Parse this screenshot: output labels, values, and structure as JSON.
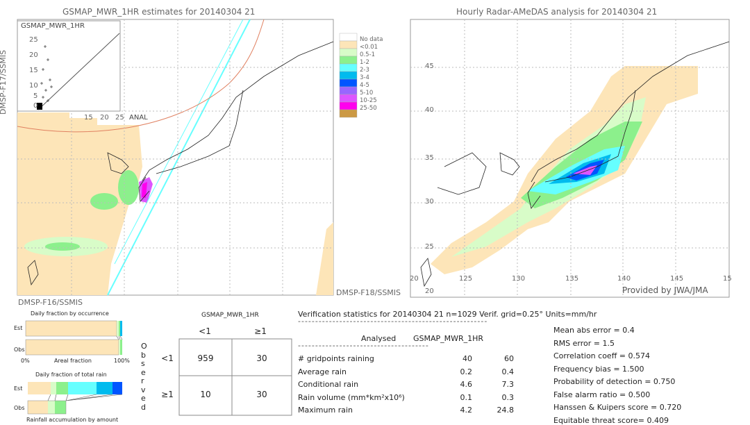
{
  "left_map": {
    "title": "GSMAP_MWR_1HR estimates for 20140304 21",
    "left_label": "DMSP-F17/SSMIS",
    "bottom_left_label": "DMSP-F16/SSMIS",
    "bottom_right_label": "DMSP-F18/SSMIS",
    "inset": {
      "title": "GSMAP_MWR_1HR",
      "xlabel": "ANAL",
      "yticks": [
        "25",
        "20",
        "15",
        "10",
        "5",
        "0"
      ],
      "xticks": [
        "15",
        "20",
        "25"
      ]
    }
  },
  "right_map": {
    "title": "Hourly Radar-AMeDAS analysis for 20140304 21",
    "lat_labels": [
      "45",
      "40",
      "35",
      "30",
      "25",
      "20"
    ],
    "lon_labels": [
      "125",
      "130",
      "135",
      "140",
      "145",
      "15"
    ],
    "left_bottom_label": "20",
    "credit": "Provided by JWA/JMA"
  },
  "legend": [
    {
      "label": "No data",
      "color": "#ffffff"
    },
    {
      "label": "No data",
      "color": "#fde5b8"
    },
    {
      "label": "<0.01",
      "color": "#d8fcc8"
    },
    {
      "label": "0.5-1",
      "color": "#8cf08c"
    },
    {
      "label": "1-2",
      "color": "#66ffff"
    },
    {
      "label": "2-3",
      "color": "#00bbee"
    },
    {
      "label": "3-4",
      "color": "#0055ff"
    },
    {
      "label": "4-5",
      "color": "#9966ff"
    },
    {
      "label": "5-10",
      "color": "#dd55ff"
    },
    {
      "label": "10-25",
      "color": "#ff00ee"
    },
    {
      "label": "25-50",
      "color": "#cc9944"
    }
  ],
  "occurrence": {
    "title": "Daily fraction by occurrence",
    "est": "Est",
    "obs": "Obs",
    "axis_left": "0%",
    "axis_mid": "Areal fraction",
    "axis_right": "100%"
  },
  "total_rain": {
    "title": "Daily fraction of total rain",
    "est": "Est",
    "obs": "Obs",
    "footer": "Rainfall accumulation by amount"
  },
  "contingency": {
    "col_title": "GSMAP_MWR_1HR",
    "row_title": "Observed",
    "col_labels": [
      "<1",
      "≥1"
    ],
    "row_labels": [
      "<1",
      "≥1"
    ],
    "cells": [
      [
        "959",
        "30"
      ],
      [
        "10",
        "30"
      ]
    ]
  },
  "stats": {
    "header": "Verification statistics for 20140304 21  n=1029  Verif. grid=0.25°  Units=mm/hr",
    "dashes1": "-------------------------------------------------------",
    "col_headers": [
      "Analysed",
      "GSMAP_MWR_1HR"
    ],
    "dashes2": "--------------------------------------",
    "rows": [
      {
        "label": "# gridpoints raining",
        "a": "40",
        "b": "60"
      },
      {
        "label": "Average rain",
        "a": "0.2",
        "b": "0.4"
      },
      {
        "label": "Conditional rain",
        "a": "4.6",
        "b": "7.3"
      },
      {
        "label": "Rain volume (mm*km²x10⁶)",
        "a": "0.1",
        "b": "0.3"
      },
      {
        "label": "Maximum rain",
        "a": "4.2",
        "b": "24.8"
      }
    ],
    "scores": [
      "Mean abs error = 0.4",
      "RMS error = 1.5",
      "Correlation coeff = 0.574",
      "Frequency bias = 1.500",
      "Probability of detection = 0.750",
      "False alarm ratio = 0.500",
      "Hanssen & Kuipers score = 0.720",
      "Equitable threat score= 0.409"
    ]
  }
}
